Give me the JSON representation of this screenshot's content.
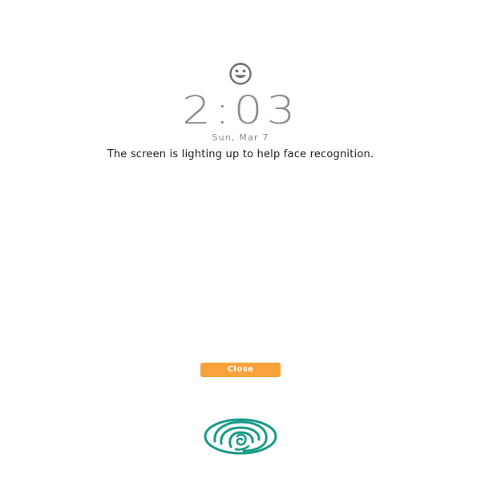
{
  "lockscreen": {
    "face_icon": "smiley-face-icon",
    "time": "2:03",
    "date": "Sun, Mar 7",
    "message": "The screen is lighting up to help face recognition.",
    "close_label": "Close",
    "fingerprint_icon": "fingerprint-icon"
  },
  "colors": {
    "clock_gray": "#8e8e8e",
    "button_orange": "#f7a23a",
    "fingerprint_teal": "#1a9b86"
  }
}
